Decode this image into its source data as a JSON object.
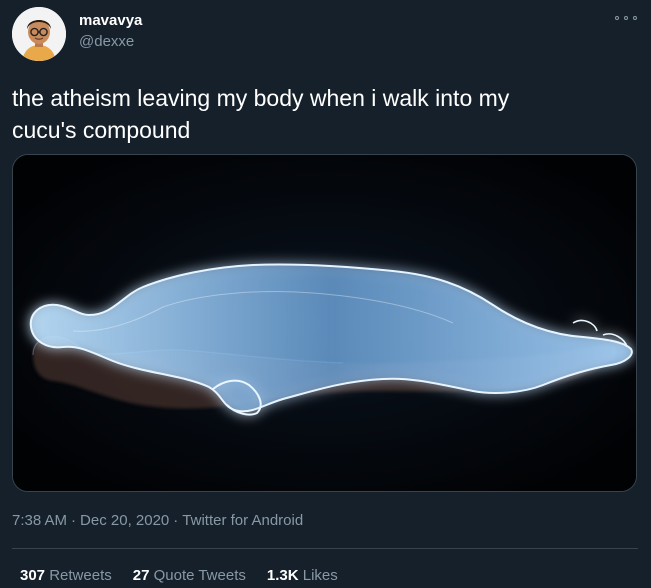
{
  "user": {
    "display_name": "mavavya",
    "handle": "@dexxe",
    "avatar_icon": "avatar-icon"
  },
  "tweet": {
    "text": "the atheism leaving my body when i walk into my\ncucu's compound",
    "media_description_icon": "astral-projection-image"
  },
  "meta": {
    "time": "7:38 AM",
    "date": "Dec 20, 2020",
    "source": "Twitter for Android",
    "separator": "·"
  },
  "stats": {
    "retweets_count": "307",
    "retweets_label": "Retweets",
    "quotes_count": "27",
    "quotes_label": "Quote Tweets",
    "likes_count": "1.3K",
    "likes_label": "Likes"
  },
  "colors": {
    "background": "#15202b",
    "secondary_text": "#8899a6",
    "border": "#38444d"
  }
}
